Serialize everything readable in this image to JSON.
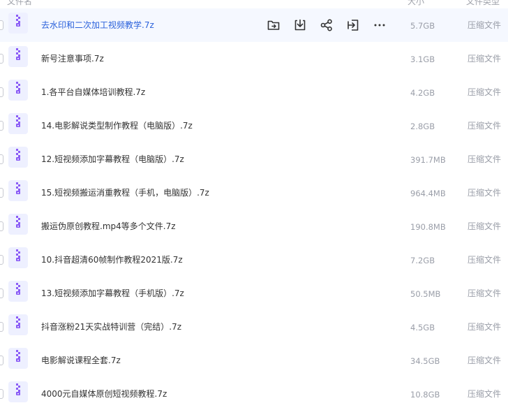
{
  "header": {
    "name_col": "文件名",
    "size_col": "大小",
    "type_col": "文件类型"
  },
  "colors": {
    "accent": "#2a61db",
    "hover_row": "#f5f8ff",
    "icon_bg": "#eef0ff",
    "icon_fg": "#8b5cf6"
  },
  "row_actions": [
    "move-to-folder-icon",
    "download-icon",
    "share-icon",
    "export-icon",
    "more-icon"
  ],
  "files": [
    {
      "name": "去水印和二次加工视频教学.7z",
      "size": "5.7GB",
      "type": "压缩文件",
      "icon": "zip-file-icon"
    },
    {
      "name": "新号注意事项.7z",
      "size": "3.1GB",
      "type": "压缩文件",
      "icon": "zip-file-icon"
    },
    {
      "name": "1.各平台自媒体培训教程.7z",
      "size": "4.2GB",
      "type": "压缩文件",
      "icon": "zip-file-icon"
    },
    {
      "name": "14.电影解说类型制作教程（电脑版）.7z",
      "size": "2.8GB",
      "type": "压缩文件",
      "icon": "zip-file-icon"
    },
    {
      "name": "12.短视频添加字幕教程（电脑版）.7z",
      "size": "391.7MB",
      "type": "压缩文件",
      "icon": "zip-file-icon"
    },
    {
      "name": "15.短视频搬运消重教程（手机，电脑版）.7z",
      "size": "964.4MB",
      "type": "压缩文件",
      "icon": "zip-file-icon"
    },
    {
      "name": "搬运伪原创教程.mp4等多个文件.7z",
      "size": "190.8MB",
      "type": "压缩文件",
      "icon": "zip-file-icon"
    },
    {
      "name": "10.抖音超清60帧制作教程2021版.7z",
      "size": "7.2GB",
      "type": "压缩文件",
      "icon": "zip-file-icon"
    },
    {
      "name": "13.短视频添加字幕教程（手机版）.7z",
      "size": "50.5MB",
      "type": "压缩文件",
      "icon": "zip-file-icon"
    },
    {
      "name": "抖音涨粉21天实战特训营（完结）.7z",
      "size": "4.5GB",
      "type": "压缩文件",
      "icon": "zip-file-icon"
    },
    {
      "name": "电影解说课程全套.7z",
      "size": "34.5GB",
      "type": "压缩文件",
      "icon": "zip-file-icon"
    },
    {
      "name": "4000元自媒体原创短视频教程.7z",
      "size": "10.8GB",
      "type": "压缩文件",
      "icon": "zip-file-icon"
    }
  ]
}
